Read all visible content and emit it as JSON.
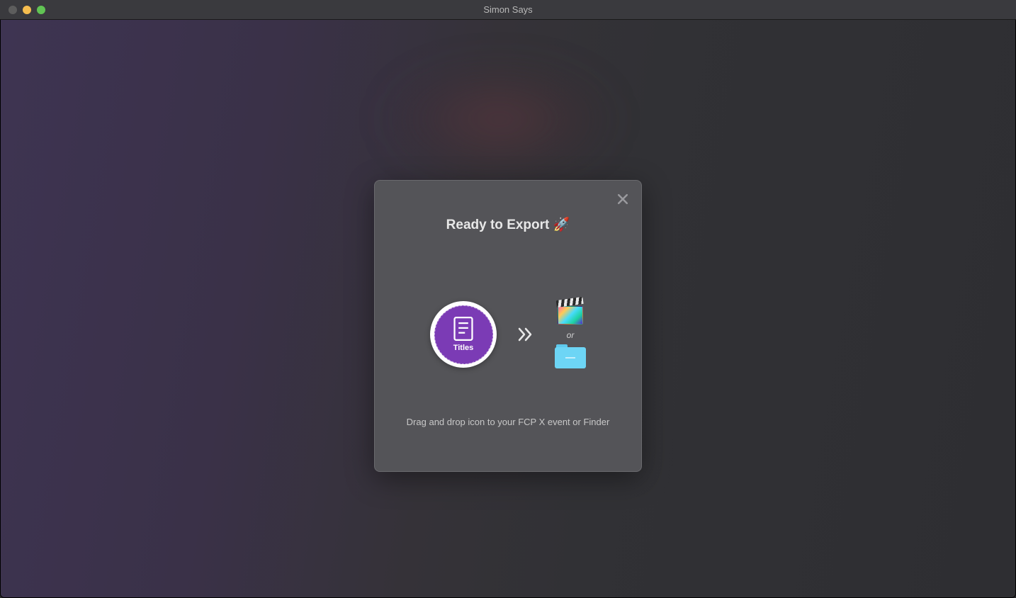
{
  "window": {
    "title": "Simon Says"
  },
  "modal": {
    "title": "Ready to Export 🚀",
    "badge_label": "Titles",
    "or_text": "or",
    "instruction": "Drag and drop icon to your FCP X event or Finder"
  }
}
